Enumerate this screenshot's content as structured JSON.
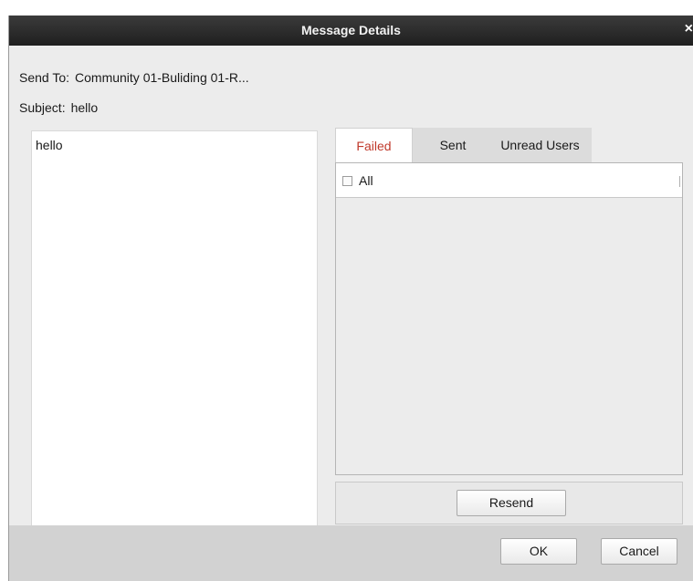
{
  "window": {
    "title": "Message Details",
    "close_glyph": "×"
  },
  "info": {
    "send_to_label": "Send To:",
    "send_to_value": "Community 01-Buliding 01-R...",
    "subject_label": "Subject:",
    "subject_value": "hello"
  },
  "message": {
    "body": "hello"
  },
  "tabs": [
    {
      "label": "Failed",
      "active": true
    },
    {
      "label": "Sent",
      "active": false
    },
    {
      "label": "Unread Users",
      "active": false
    }
  ],
  "list": {
    "all_label": "All",
    "all_checked": false
  },
  "actions": {
    "resend": "Resend",
    "ok": "OK",
    "cancel": "Cancel"
  },
  "colors": {
    "titlebar": "#2b2b2b",
    "active_tab_text": "#c0392b",
    "dialog_bg": "#ececec"
  }
}
